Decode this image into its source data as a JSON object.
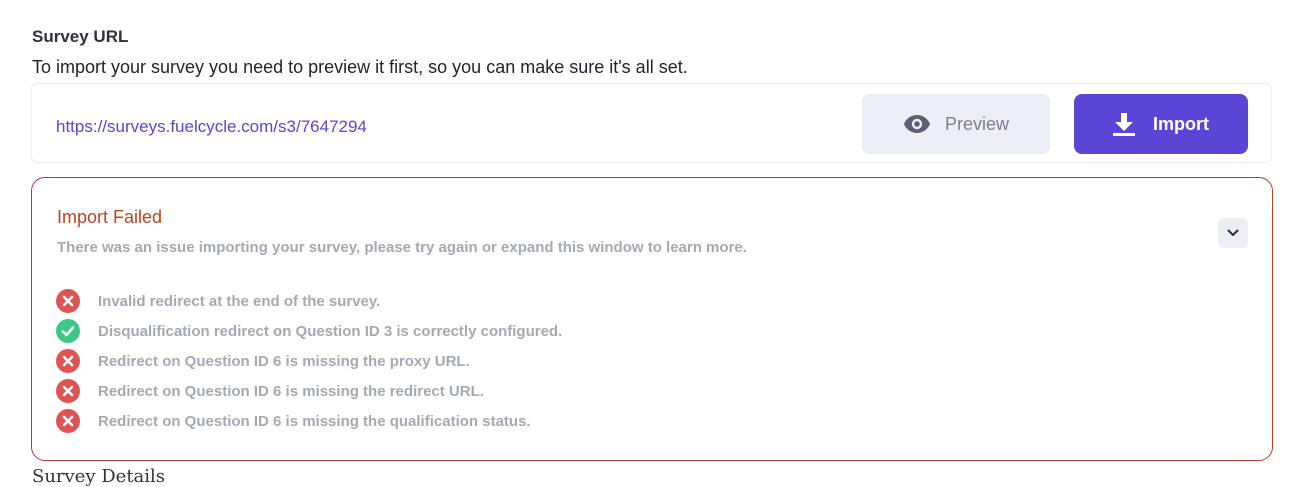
{
  "survey_url_section": {
    "title": "Survey URL",
    "description": "To import your survey you need to preview it first, so you can make sure it's all set.",
    "url": "https://surveys.fuelcycle.com/s3/7647294",
    "preview_label": "Preview",
    "preview_icon": "eye-icon",
    "import_label": "Import",
    "import_icon": "download-icon"
  },
  "import_status": {
    "title": "Import Failed",
    "subtitle": "There was an issue importing your survey, please try again or expand this window to learn more.",
    "toggle_icon": "chevron-down-icon",
    "checks": [
      {
        "status": "error",
        "text": "Invalid redirect at the end of the survey."
      },
      {
        "status": "success",
        "text": "Disqualification redirect on Question ID 3 is correctly configured."
      },
      {
        "status": "error",
        "text": "Redirect on Question ID 6 is missing the proxy URL."
      },
      {
        "status": "error",
        "text": "Redirect on Question ID 6 is missing the redirect URL."
      },
      {
        "status": "error",
        "text": "Redirect on Question ID 6 is missing the qualification status."
      }
    ]
  },
  "footer": {
    "partial_text": "Survey Details"
  },
  "colors": {
    "accent": "#5b45d6",
    "error": "#e05353",
    "success": "#3cc985",
    "error_border": "#b43a2a",
    "error_title": "#c0431f"
  }
}
